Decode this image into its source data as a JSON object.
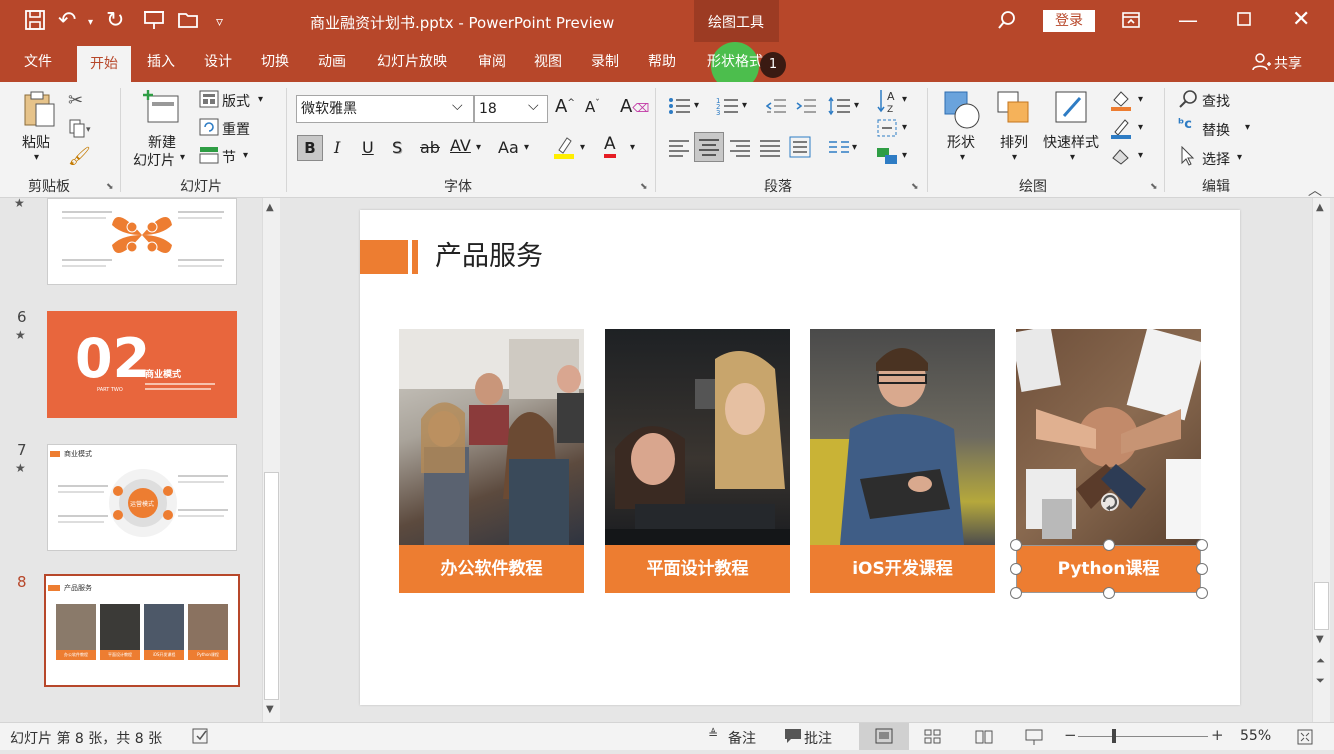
{
  "title_bar": {
    "doc_title": "商业融资计划书.pptx - PowerPoint Preview",
    "context_tools": "绘图工具",
    "login_label": "登录"
  },
  "tabs": [
    {
      "label": "文件"
    },
    {
      "label": "开始"
    },
    {
      "label": "插入"
    },
    {
      "label": "设计"
    },
    {
      "label": "切换"
    },
    {
      "label": "动画"
    },
    {
      "label": "幻灯片放映"
    },
    {
      "label": "审阅"
    },
    {
      "label": "视图"
    },
    {
      "label": "录制"
    },
    {
      "label": "帮助"
    },
    {
      "label": "形状格式"
    }
  ],
  "tab_badge": "1",
  "share_label": "共享",
  "ribbon": {
    "clipboard": {
      "paste": "粘贴",
      "group": "剪贴板"
    },
    "slides": {
      "new_slide": "新建",
      "new_slide2": "幻灯片",
      "layout": "版式",
      "reset": "重置",
      "section": "节",
      "group": "幻灯片"
    },
    "font": {
      "font_name": "微软雅黑",
      "font_size": "18",
      "group": "字体",
      "bold": "B",
      "italic": "I",
      "underline": "U",
      "shadow": "S",
      "strike": "ab",
      "spacing": "AV",
      "case": "Aa",
      "color": "A"
    },
    "paragraph": {
      "group": "段落"
    },
    "drawing": {
      "shapes": "形状",
      "arrange": "排列",
      "quick_styles": "快速样式",
      "group": "绘图"
    },
    "editing": {
      "find": "查找",
      "replace": "替换",
      "select": "选择",
      "group": "编辑"
    }
  },
  "thumbnails": [
    {
      "num": "6",
      "big": "02",
      "title": "商业模式",
      "sub": "PART TWO"
    },
    {
      "num": "7",
      "title": "商业模式",
      "center": "运营模式"
    },
    {
      "num": "8",
      "title": "产品服务",
      "caps": [
        "办公软件教程",
        "平面设计教程",
        "iOS开发课程",
        "Python课程"
      ]
    }
  ],
  "slide": {
    "title": "产品服务",
    "cards": [
      {
        "caption": "办公软件教程"
      },
      {
        "caption": "平面设计教程"
      },
      {
        "caption": "iOS开发课程"
      },
      {
        "caption": "Python课程"
      }
    ]
  },
  "status": {
    "slide_info": "幻灯片 第 8 张，共 8 张",
    "notes": "备注",
    "comments": "批注",
    "zoom": "55%"
  },
  "colors": {
    "brand": "#b7472a",
    "accent": "#ed7d31",
    "highlight": "#39d353"
  }
}
